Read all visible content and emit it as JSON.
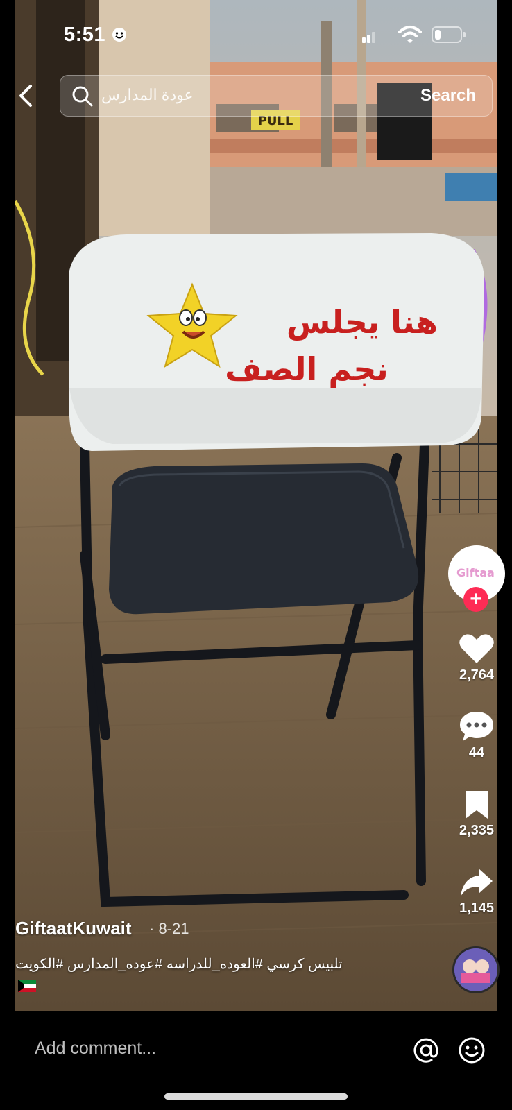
{
  "status": {
    "time": "5:51"
  },
  "search": {
    "query": "عودة المدارس",
    "button_label": "Search"
  },
  "chair_cover": {
    "line1": "هنا يجلس",
    "line2": "نجم الصف"
  },
  "storefront_sign": "PULL",
  "creator": {
    "avatar_text": "Giftaa"
  },
  "actions": {
    "likes": "2,764",
    "comments": "44",
    "saves": "2,335",
    "shares": "1,145"
  },
  "post": {
    "username": "GiftaatKuwait",
    "date": "· 8-21",
    "caption": "تلبيس كرسي  #العوده_للدراسه  #عوده_المدارس #الكويت"
  },
  "composer": {
    "placeholder": "Add comment..."
  },
  "colors": {
    "follow_badge": "#fe2c55",
    "chair_text": "#c8201f",
    "star": "#f2d227"
  },
  "icons": [
    "back-icon",
    "search-icon",
    "heart-icon",
    "comment-icon",
    "bookmark-icon",
    "share-icon",
    "at-icon",
    "emoji-icon",
    "smiley-icon",
    "wifi-icon",
    "battery-icon",
    "signal-icon"
  ]
}
